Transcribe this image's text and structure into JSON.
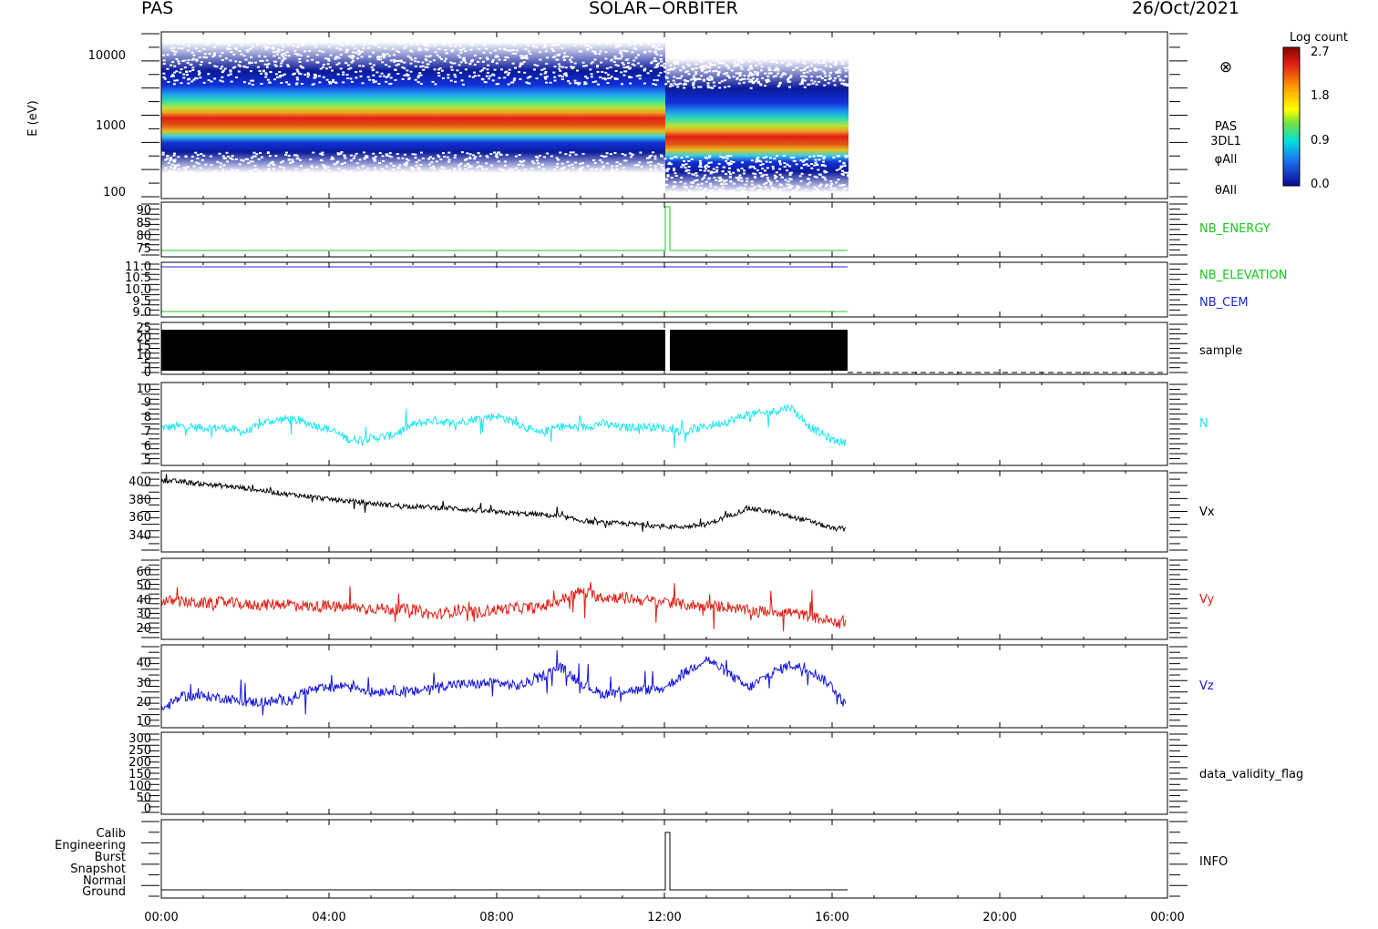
{
  "header": {
    "left": "PAS",
    "center": "SOLAR−ORBITER",
    "right": "26/Oct/2021"
  },
  "colorbar": {
    "title": "Log count",
    "ticks": [
      "2.7",
      "1.8",
      "0.9",
      "0.0"
    ],
    "range": [
      0.0,
      2.7
    ]
  },
  "x_axis": {
    "tick_labels": [
      "00:00",
      "04:00",
      "08:00",
      "12:00",
      "16:00",
      "20:00",
      "00:00"
    ],
    "data_end": "16:20",
    "gap_start": "12:00",
    "gap_end": "12:05"
  },
  "colors": {
    "green": "#19c81e",
    "blue": "#1e2ad2",
    "cyan": "#1ee6f0",
    "red": "#e01e14",
    "vz_blue": "#1414dc"
  },
  "chart_data": [
    {
      "type": "heatmap",
      "name": "spectrogram",
      "ylabel": "E (eV)",
      "yscale": "log",
      "ylim": [
        100,
        15000
      ],
      "ytick_labels": [
        "10000",
        "1000",
        "100"
      ],
      "side_labels": [
        "PAS",
        "3DL1",
        "φAll",
        "θAll"
      ],
      "symbol": "⊗",
      "energy_range_before_gap": [
        200,
        15000
      ],
      "energy_range_after_gap": [
        100,
        9000
      ],
      "peak_energy_eV": 700
    },
    {
      "type": "line",
      "name": "nb_energy",
      "label": "NB_ENERGY",
      "ytick_labels": [
        "90",
        "85",
        "80",
        "75"
      ],
      "ylim": [
        70,
        92
      ],
      "series": [
        {
          "name": "NB_ENERGY",
          "base": 74,
          "spike_value": 91
        }
      ]
    },
    {
      "type": "line",
      "name": "nb_elevation_cem",
      "ytick_labels": [
        "11.0",
        "10.5",
        "10.0",
        "9.5",
        "9.0"
      ],
      "ylim": [
        8.9,
        11.05
      ],
      "series": [
        {
          "name": "NB_ELEVATION",
          "value": 9.0
        },
        {
          "name": "NB_CEM",
          "value": 11.0
        }
      ]
    },
    {
      "type": "bar",
      "name": "sample",
      "label": "sample",
      "ytick_labels": [
        "25",
        "20",
        "15",
        "10",
        "5",
        "0"
      ],
      "ylim": [
        0,
        25
      ],
      "min_value": 0,
      "max_value": 23
    },
    {
      "type": "line",
      "name": "density",
      "label": "N",
      "ytick_labels": [
        "10",
        "9",
        "8",
        "7",
        "6",
        "5"
      ],
      "ylim": [
        4.5,
        10
      ],
      "x_hours": [
        0,
        0.5,
        1,
        1.5,
        2,
        2.5,
        3,
        3.5,
        4,
        4.5,
        5,
        5.5,
        6,
        6.5,
        7,
        7.5,
        8,
        8.5,
        9,
        9.5,
        10,
        10.5,
        11,
        11.5,
        12,
        12.5,
        13,
        13.5,
        14,
        14.5,
        15,
        15.5,
        16,
        16.33
      ],
      "y": [
        7.0,
        7.1,
        7.0,
        7.0,
        6.7,
        7.4,
        7.6,
        7.3,
        6.9,
        6.2,
        6.3,
        6.5,
        7.2,
        7.5,
        7.3,
        7.6,
        7.8,
        7.3,
        6.6,
        7.1,
        7.0,
        7.3,
        7.0,
        7.1,
        7.0,
        6.7,
        7.1,
        7.4,
        7.9,
        8.0,
        8.4,
        7.0,
        6.2,
        6.0
      ]
    },
    {
      "type": "line",
      "name": "vx",
      "label": "Vx",
      "ytick_labels": [
        "400",
        "380",
        "360",
        "340"
      ],
      "ylim": [
        325,
        405
      ],
      "x_hours": [
        0,
        0.5,
        1,
        1.5,
        2,
        2.5,
        3,
        3.5,
        4,
        4.5,
        5,
        5.5,
        6,
        6.5,
        7,
        7.5,
        8,
        8.5,
        9,
        9.5,
        10,
        10.5,
        11,
        11.5,
        12,
        12.5,
        13,
        13.5,
        14,
        14.5,
        15,
        15.5,
        16,
        16.33
      ],
      "y": [
        396,
        394,
        392,
        390,
        388,
        385,
        382,
        380,
        377,
        375,
        373,
        371,
        370,
        369,
        368,
        366,
        364,
        363,
        362,
        360,
        356,
        354,
        353,
        352,
        350,
        350,
        352,
        360,
        368,
        365,
        360,
        355,
        348,
        348
      ]
    },
    {
      "type": "line",
      "name": "vy",
      "label": "Vy",
      "ytick_labels": [
        "60",
        "50",
        "40",
        "30",
        "20"
      ],
      "ylim": [
        12,
        66
      ],
      "x_hours": [
        0,
        0.5,
        1,
        1.5,
        2,
        2.5,
        3,
        3.5,
        4,
        4.5,
        5,
        5.5,
        6,
        6.5,
        7,
        7.5,
        8,
        8.5,
        9,
        9.5,
        10,
        10.5,
        11,
        11.5,
        12,
        12.5,
        13,
        13.5,
        14,
        14.5,
        15,
        15.5,
        16,
        16.33
      ],
      "y": [
        38,
        37,
        36,
        37,
        35,
        35,
        36,
        34,
        34,
        33,
        33,
        32,
        32,
        28,
        31,
        30,
        32,
        33,
        33,
        38,
        44,
        40,
        40,
        38,
        37,
        35,
        34,
        34,
        31,
        31,
        30,
        27,
        24,
        24
      ]
    },
    {
      "type": "line",
      "name": "vz",
      "label": "Vz",
      "ytick_labels": [
        "40",
        "30",
        "20",
        "10"
      ],
      "ylim": [
        5,
        47
      ],
      "x_hours": [
        0,
        0.5,
        1,
        1.5,
        2,
        2.5,
        3,
        3.5,
        4,
        4.5,
        5,
        5.5,
        6,
        6.5,
        7,
        7.5,
        8,
        8.5,
        9,
        9.5,
        10,
        10.5,
        11,
        11.5,
        12,
        12.5,
        13,
        13.5,
        14,
        14.5,
        15,
        15.5,
        16,
        16.33
      ],
      "y": [
        14,
        21,
        21,
        20,
        18,
        18,
        19,
        24,
        25,
        27,
        23,
        24,
        23,
        26,
        27,
        27,
        28,
        26,
        30,
        36,
        28,
        22,
        24,
        24,
        25,
        33,
        40,
        33,
        25,
        32,
        37,
        34,
        26,
        16
      ]
    },
    {
      "type": "line",
      "name": "data_validity_flag",
      "label": "data_validity_flag",
      "ytick_labels": [
        "300",
        "250",
        "200",
        "150",
        "100",
        "50",
        "0"
      ],
      "ylim": [
        -20,
        310
      ],
      "series": []
    },
    {
      "type": "line",
      "name": "info",
      "label": "INFO",
      "ytick_labels": [
        "Calib",
        "Engineering",
        "Burst",
        "Snapshot",
        "Normal",
        "Ground"
      ],
      "levels": [
        "Ground",
        "Normal",
        "Snapshot",
        "Burst",
        "Engineering",
        "Calib"
      ],
      "series": [
        {
          "name": "mode",
          "base": "Ground",
          "spike": "Calib"
        }
      ]
    }
  ]
}
